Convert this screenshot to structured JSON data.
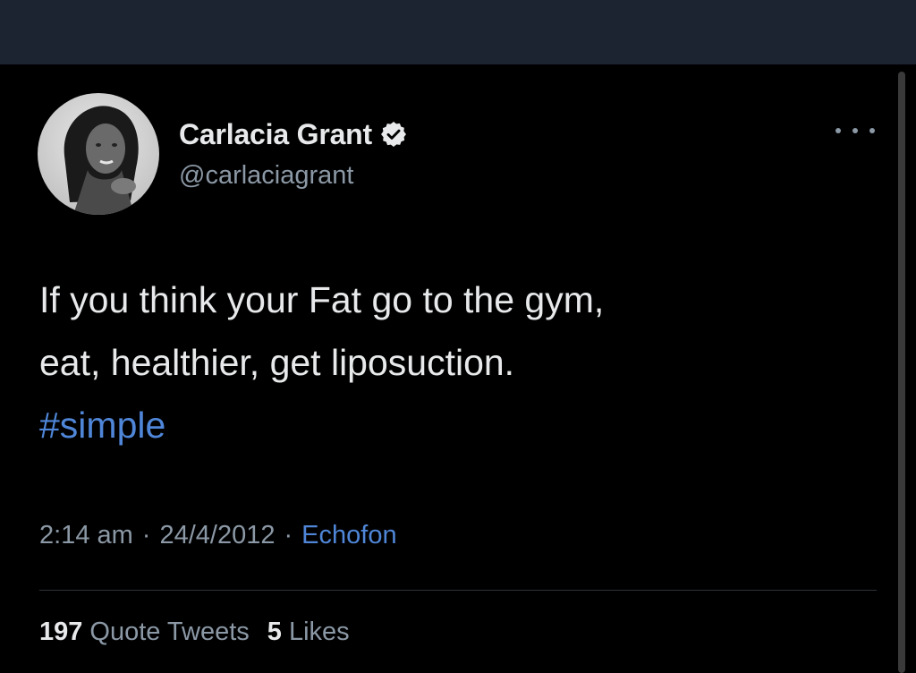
{
  "tweet": {
    "author": {
      "display_name": "Carlacia Grant",
      "handle": "@carlaciagrant",
      "verified": true,
      "avatar_icon": "profile-photo"
    },
    "more_icon": "more-horizontal-icon",
    "text_lines": [
      "If you think your Fat go to the gym,",
      "eat, healthier, get liposuction."
    ],
    "hashtag": "#simple",
    "time": "2:14 am",
    "date": "24/4/2012",
    "source": "Echofon",
    "separator": "·",
    "stats": {
      "quote_tweets_count": "197",
      "quote_tweets_label": "Quote Tweets",
      "likes_count": "5",
      "likes_label": "Likes"
    }
  },
  "colors": {
    "background": "#000000",
    "top_bar": "#1b2430",
    "primary_text": "#e7e9ea",
    "secondary_text": "#8b98a5",
    "link": "#4f86d8"
  }
}
